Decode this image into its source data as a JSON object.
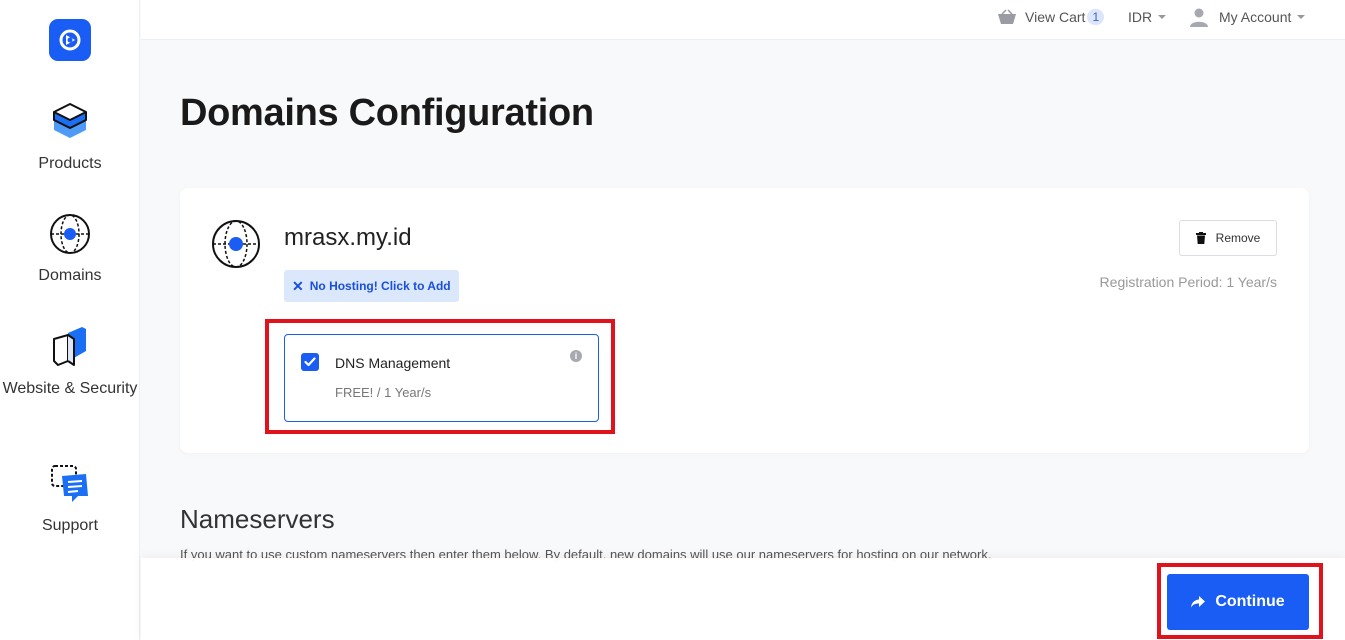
{
  "sidebar": {
    "items": [
      {
        "label": "Products"
      },
      {
        "label": "Domains"
      },
      {
        "label": "Website & Security"
      },
      {
        "label": "Support"
      }
    ]
  },
  "topbar": {
    "cart_label": "View Cart",
    "cart_count": "1",
    "currency": "IDR",
    "account_label": "My Account"
  },
  "page": {
    "title": "Domains Configuration"
  },
  "domain_card": {
    "domain": "mrasx.my.id",
    "no_hosting_label": "No Hosting! Click to Add",
    "remove_label": "Remove",
    "registration_period": "Registration Period: 1 Year/s",
    "addon": {
      "title": "DNS Management",
      "price": "FREE! / 1 Year/s",
      "checked": true
    }
  },
  "nameservers": {
    "title": "Nameservers",
    "description": "If you want to use custom nameservers then enter them below. By default, new domains will use our nameservers for hosting on our network."
  },
  "footer": {
    "continue_label": "Continue"
  },
  "colors": {
    "accent": "#1a5df5",
    "highlight": "#e0131d"
  }
}
